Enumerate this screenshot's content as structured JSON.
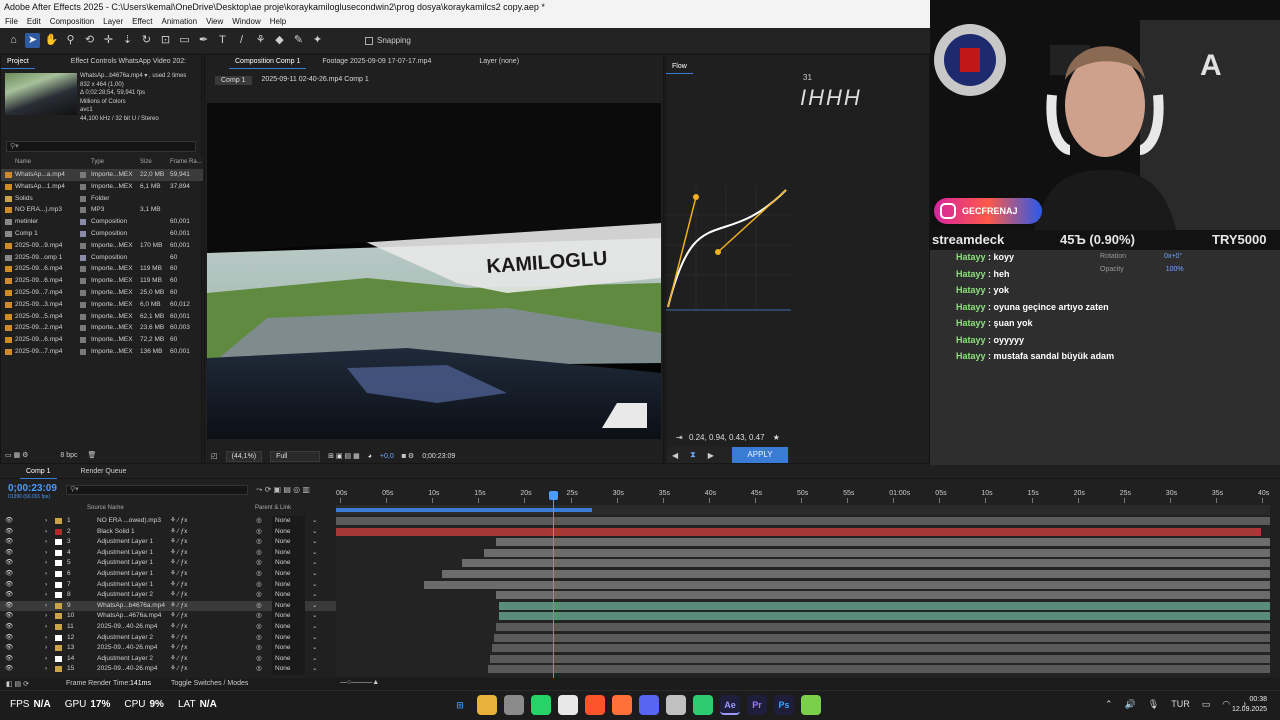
{
  "window": {
    "title": "Adobe After Effects 2025 - C:\\Users\\kemal\\OneDrive\\Desktop\\ae proje\\koraykamiloglusecondwin2\\prog dosya\\koraykamilcs2 copy.aep *"
  },
  "menu": [
    "File",
    "Edit",
    "Composition",
    "Layer",
    "Effect",
    "Animation",
    "View",
    "Window",
    "Help"
  ],
  "toolbar": {
    "snapping": "Snapping"
  },
  "project": {
    "tabs": [
      "Project",
      "Effect Controls WhatsApp Video 202:"
    ],
    "file_info": [
      "WhatsAp...b4676a.mp4 ▾ , used 2 times",
      "832 x 464 (1,00)",
      "Δ 0;02:28;54, 59,941 fps",
      "Millions of Colors",
      "avc1",
      "44,100 kHz / 32 bit U / Stereo"
    ],
    "search_placeholder": "",
    "columns": [
      "Name",
      "Type",
      "Size",
      "Frame Ra..."
    ],
    "items": [
      {
        "name": "WhatsAp...a.mp4",
        "type": "Importe...MEX",
        "size": "22,0 MB",
        "fps": "59,941",
        "color": "#d08a2a",
        "sel": true
      },
      {
        "name": "WhatsAp...1.mp4",
        "type": "Importe...MEX",
        "size": "6,1 MB",
        "fps": "37,894",
        "color": "#d08a2a"
      },
      {
        "name": "Solids",
        "type": "Folder",
        "size": "",
        "fps": "",
        "color": "#c9a24a"
      },
      {
        "name": "NO ERA...).mp3",
        "type": "MP3",
        "size": "3,1 MB",
        "fps": "",
        "color": "#d08a2a"
      },
      {
        "name": "metinler",
        "type": "Composition",
        "size": "",
        "fps": "60,001",
        "color": "#888"
      },
      {
        "name": "Comp 1",
        "type": "Composition",
        "size": "",
        "fps": "60,001",
        "color": "#888"
      },
      {
        "name": "2025-09...9.mp4",
        "type": "Importe...MEX",
        "size": "170 MB",
        "fps": "60,001",
        "color": "#d08a2a"
      },
      {
        "name": "2025-09...omp 1",
        "type": "Composition",
        "size": "",
        "fps": "60",
        "color": "#888"
      },
      {
        "name": "2025-09...6.mp4",
        "type": "Importe...MEX",
        "size": "119 MB",
        "fps": "60",
        "color": "#d08a2a"
      },
      {
        "name": "2025-09...6.mp4",
        "type": "Importe...MEX",
        "size": "119 MB",
        "fps": "60",
        "color": "#d08a2a"
      },
      {
        "name": "2025-09...7.mp4",
        "type": "Importe...MEX",
        "size": "25,0 MB",
        "fps": "60",
        "color": "#d08a2a"
      },
      {
        "name": "2025-09...3.mp4",
        "type": "Importe...MEX",
        "size": "6,0 MB",
        "fps": "60,012",
        "color": "#d08a2a"
      },
      {
        "name": "2025-09...5.mp4",
        "type": "Importe...MEX",
        "size": "62,1 MB",
        "fps": "60,001",
        "color": "#d08a2a"
      },
      {
        "name": "2025-09...2.mp4",
        "type": "Importe...MEX",
        "size": "23,6 MB",
        "fps": "60,003",
        "color": "#d08a2a"
      },
      {
        "name": "2025-09...6.mp4",
        "type": "Importe...MEX",
        "size": "72,2 MB",
        "fps": "60",
        "color": "#d08a2a"
      },
      {
        "name": "2025-09...7.mp4",
        "type": "Importe...MEX",
        "size": "136 MB",
        "fps": "60,001",
        "color": "#d08a2a"
      }
    ],
    "bpc": "8 bpc"
  },
  "viewer": {
    "tabs": [
      "Composition Comp 1",
      "Footage 2025-09-09 17-07-17.mp4",
      "Layer (none)"
    ],
    "breadcrumb": [
      "Comp 1",
      "2025-09-11 02-40-26.mp4 Comp 1"
    ],
    "zoom": "(44,1%)",
    "quality": "Full",
    "exposure": "+0,0",
    "timecode": "0;00:23:09",
    "overlay_text": "KAMILOGLU"
  },
  "flow": {
    "tab": "Flow",
    "top_number": "31",
    "values": "0.24, 0.94, 0.43, 0.47",
    "apply": "APPLY",
    "rotation_label": "Rotation",
    "rotation_value": "0x+0°",
    "opacity_label": "Opacity",
    "opacity_value": "100%"
  },
  "timeline": {
    "tabs": [
      "Comp 1",
      "Render Queue"
    ],
    "timecode": "0;00:23:09",
    "timecode_sub": "01390 (60.001 fps)",
    "columns": [
      "Source Name",
      "Parent & Link"
    ],
    "ruler": [
      "00s",
      "05s",
      "10s",
      "15s",
      "20s",
      "25s",
      "30s",
      "35s",
      "40s",
      "45s",
      "50s",
      "55s",
      "01:00s",
      "05s",
      "10s",
      "15s",
      "20s",
      "25s",
      "30s",
      "35s",
      "40s"
    ],
    "layers": [
      {
        "n": "1",
        "name": "NO ERA ...owed).mp3",
        "color": "#c9a24a",
        "parent": "None"
      },
      {
        "n": "2",
        "name": "Black Solid 1",
        "color": "#b02a2a",
        "parent": "None"
      },
      {
        "n": "3",
        "name": "Adjustment Layer 1",
        "color": "#ffffff",
        "parent": "None"
      },
      {
        "n": "4",
        "name": "Adjustment Layer 1",
        "color": "#ffffff",
        "parent": "None"
      },
      {
        "n": "5",
        "name": "Adjustment Layer 1",
        "color": "#ffffff",
        "parent": "None"
      },
      {
        "n": "6",
        "name": "Adjustment Layer 1",
        "color": "#ffffff",
        "parent": "None"
      },
      {
        "n": "7",
        "name": "Adjustment Layer 1",
        "color": "#ffffff",
        "parent": "None"
      },
      {
        "n": "8",
        "name": "Adjustment Layer 2",
        "color": "#ffffff",
        "parent": "None"
      },
      {
        "n": "9",
        "name": "WhatsAp...b4676a.mp4",
        "color": "#c9a24a",
        "parent": "None",
        "sel": true
      },
      {
        "n": "10",
        "name": "WhatsAp...4676a.mp4",
        "color": "#c9a24a",
        "parent": "None"
      },
      {
        "n": "11",
        "name": "2025-09...40-26.mp4",
        "color": "#c9a24a",
        "parent": "None"
      },
      {
        "n": "12",
        "name": "Adjustment Layer 2",
        "color": "#ffffff",
        "parent": "None"
      },
      {
        "n": "13",
        "name": "2025-09...40-26.mp4",
        "color": "#c9a24a",
        "parent": "None"
      },
      {
        "n": "14",
        "name": "Adjustment Layer 2",
        "color": "#ffffff",
        "parent": "None"
      },
      {
        "n": "15",
        "name": "2025-09...40-26.mp4",
        "color": "#c9a24a",
        "parent": "None"
      }
    ],
    "footer_render": "Frame Render Time:",
    "render_time": "141ms",
    "toggle": "Toggle Switches / Modes"
  },
  "stream": {
    "instagram": "GECFRENAJ",
    "streamdeck": "streamdeck",
    "price": "45Ъ (0.90%)",
    "currency": "TRY5000",
    "chat": [
      {
        "user": "Hatayy",
        "msg": "koyy"
      },
      {
        "user": "Hatayy",
        "msg": "heh"
      },
      {
        "user": "Hatayy",
        "msg": "yok"
      },
      {
        "user": "Hatayy",
        "msg": "oyuna geçince artıyo zaten"
      },
      {
        "user": "Hatayy",
        "msg": "şuan yok"
      },
      {
        "user": "Hatayy",
        "msg": "oyyyyy"
      },
      {
        "user": "Hatayy",
        "msg": "mustafa sandal büyük adam"
      }
    ]
  },
  "taskbar": {
    "stats": [
      {
        "k": "FPS",
        "v": "N/A"
      },
      {
        "k": "GPU",
        "v": "17%"
      },
      {
        "k": "CPU",
        "v": "9%"
      },
      {
        "k": "LAT",
        "v": "N/A"
      }
    ],
    "apps": [
      "windows-icon",
      "file-explorer-icon",
      "app-icon",
      "whatsapp-icon",
      "chrome-icon",
      "brave-icon",
      "firefox-icon",
      "discord-icon",
      "steam-icon",
      "vpn-icon",
      "after-effects-icon",
      "premiere-icon",
      "photoshop-icon",
      "terminal-icon"
    ],
    "lang": "TUR",
    "time": "00:38",
    "date": "12.09.2025"
  }
}
